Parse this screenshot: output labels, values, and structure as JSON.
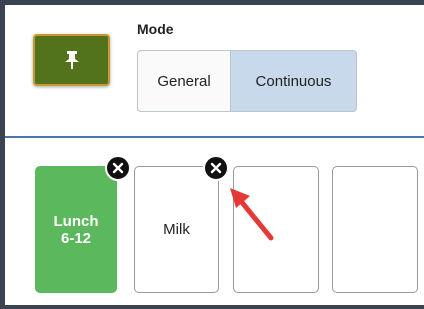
{
  "mode": {
    "label": "Mode",
    "options": [
      "General",
      "Continuous"
    ],
    "selected": "Continuous"
  },
  "tiles": [
    {
      "line1": "Lunch",
      "line2": "6-12",
      "color": "#5cb85c"
    },
    {
      "label": "Milk"
    },
    {
      "label": ""
    },
    {
      "label": ""
    }
  ],
  "icons": {
    "pin": "pushpin-icon",
    "remove": "close-circle-icon",
    "annotation": "red-arrow-icon"
  },
  "colors": {
    "pin_button": "#52731c",
    "pin_button_border": "#c69a2d",
    "selected_segment": "#c9d9ec",
    "divider": "#4a78a6",
    "arrow": "#e53935"
  }
}
